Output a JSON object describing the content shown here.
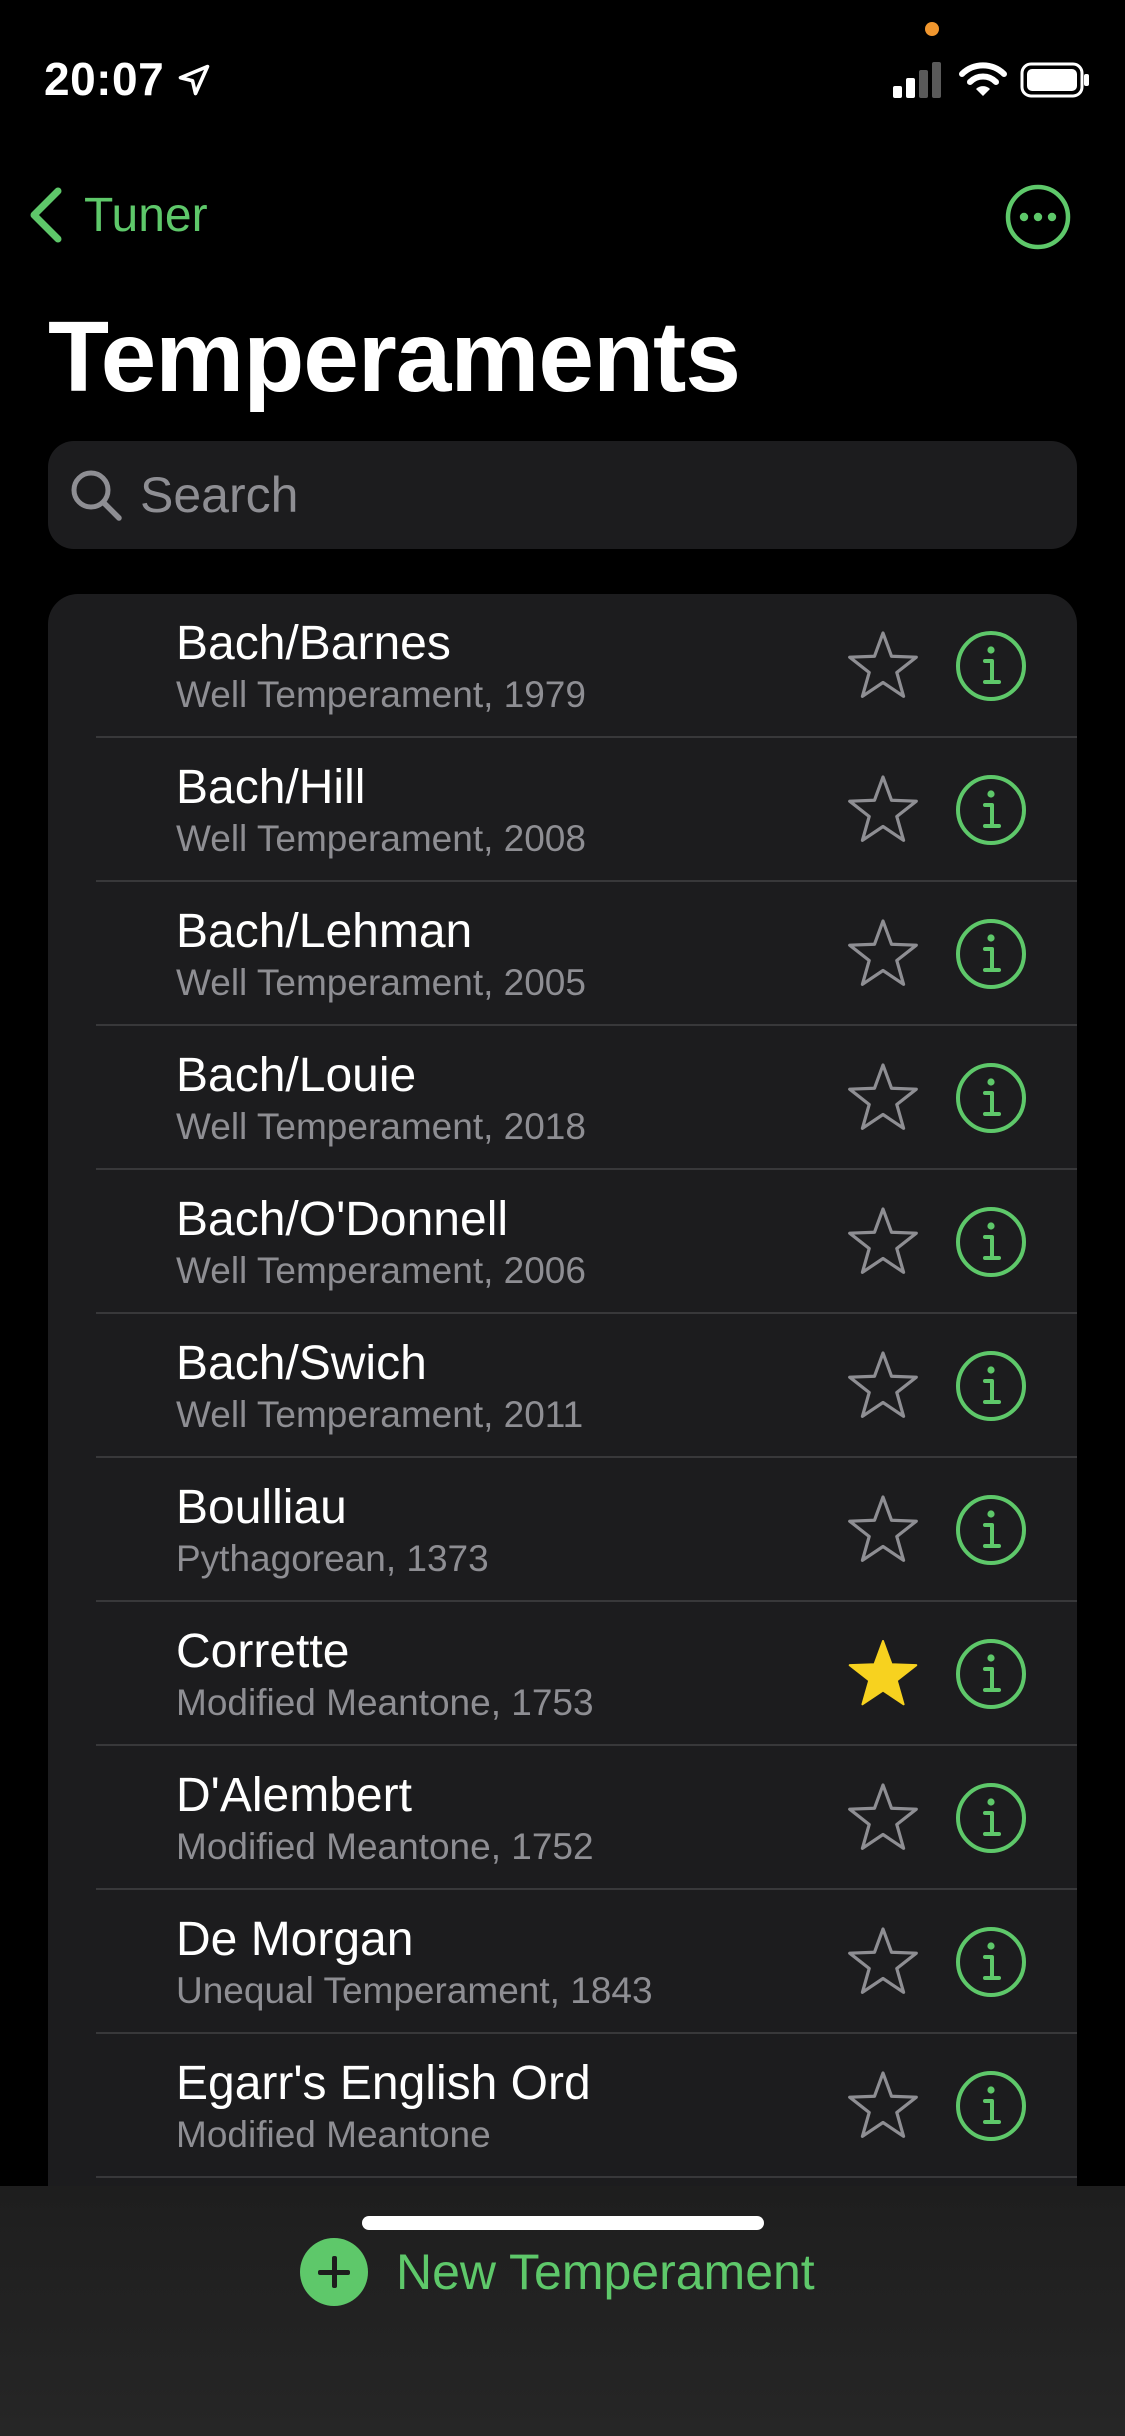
{
  "status_bar": {
    "time": "20:07",
    "icons": [
      "location-arrow-icon",
      "signal-icon",
      "wifi-icon",
      "battery-icon"
    ],
    "indicator_color": "#f0962e"
  },
  "nav": {
    "back_label": "Tuner",
    "more_icon": "ellipsis-circle-icon"
  },
  "page_title": "Temperaments",
  "search": {
    "placeholder": "Search"
  },
  "accent_color": "#5ec86a",
  "favorite_color": "#f7d21f",
  "temperaments": [
    {
      "name": "Bach/Barnes",
      "detail": "Well Temperament, 1979",
      "favorite": false
    },
    {
      "name": "Bach/Hill",
      "detail": "Well Temperament, 2008",
      "favorite": false
    },
    {
      "name": "Bach/Lehman",
      "detail": "Well Temperament, 2005",
      "favorite": false
    },
    {
      "name": "Bach/Louie",
      "detail": "Well Temperament, 2018",
      "favorite": false
    },
    {
      "name": "Bach/O'Donnell",
      "detail": "Well Temperament, 2006",
      "favorite": false
    },
    {
      "name": "Bach/Swich",
      "detail": "Well Temperament, 2011",
      "favorite": false
    },
    {
      "name": "Boulliau",
      "detail": "Pythagorean, 1373",
      "favorite": false
    },
    {
      "name": "Corrette",
      "detail": "Modified Meantone, 1753",
      "favorite": true
    },
    {
      "name": "D'Alembert",
      "detail": "Modified Meantone, 1752",
      "favorite": false
    },
    {
      "name": "De Morgan",
      "detail": "Unequal Temperament, 1843",
      "favorite": false
    },
    {
      "name": "Egarr's English Ord",
      "detail": "Modified Meantone",
      "favorite": false
    }
  ],
  "toolbar": {
    "new_label": "New Temperament"
  }
}
